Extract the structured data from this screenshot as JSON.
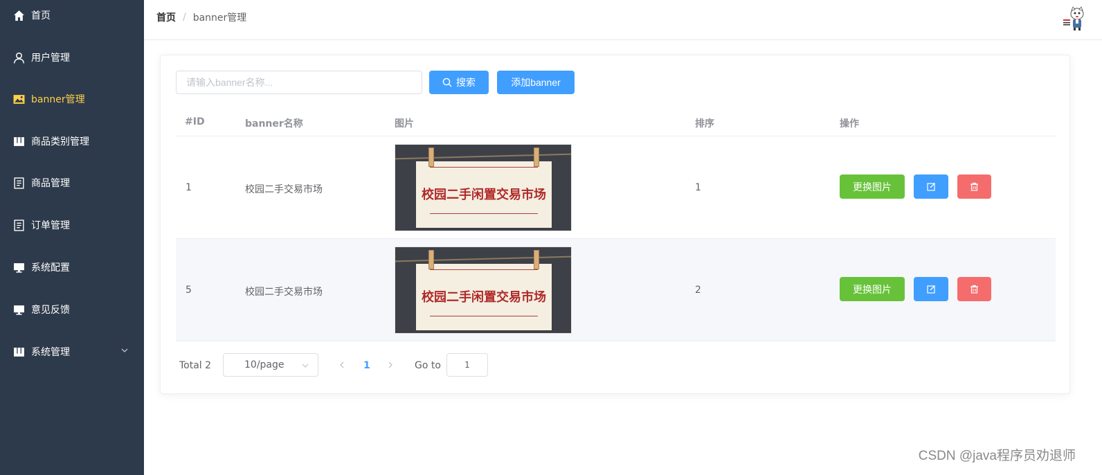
{
  "sidebar": {
    "items": [
      {
        "label": "首页",
        "icon": "home-icon"
      },
      {
        "label": "用户管理",
        "icon": "user-icon"
      },
      {
        "label": "banner管理",
        "icon": "picture-icon",
        "active": true
      },
      {
        "label": "商品类别管理",
        "icon": "category-icon"
      },
      {
        "label": "商品管理",
        "icon": "document-icon"
      },
      {
        "label": "订单管理",
        "icon": "document-icon"
      },
      {
        "label": "系统配置",
        "icon": "monitor-icon"
      },
      {
        "label": "意见反馈",
        "icon": "monitor-icon"
      },
      {
        "label": "系统管理",
        "icon": "category-icon",
        "expandable": true
      }
    ],
    "bg_color": "#2d3a4b",
    "active_color": "#ffd04b"
  },
  "header": {
    "breadcrumb_home": "首页",
    "breadcrumb_separator": "/",
    "breadcrumb_current": "banner管理"
  },
  "toolbar": {
    "search_placeholder": "请输入banner名称...",
    "search_label": "搜索",
    "add_label": "添加banner"
  },
  "table": {
    "columns": [
      "#ID",
      "banner名称",
      "图片",
      "排序",
      "操作"
    ],
    "rows": [
      {
        "id": "1",
        "name": "校园二手交易市场",
        "image_text": "校园二手闲置交易市场",
        "sort": "1"
      },
      {
        "id": "5",
        "name": "校园二手交易市场",
        "image_text": "校园二手闲置交易市场",
        "sort": "2"
      }
    ],
    "replace_label": "更换图片"
  },
  "pagination": {
    "total": "Total 2",
    "page_size": "10/page",
    "current_page": "1",
    "goto_label": "Go to",
    "goto_value": "1"
  },
  "watermark": "CSDN @java程序员劝退师",
  "colors": {
    "primary": "#409eff",
    "success": "#67c23a",
    "danger": "#f56c6c"
  }
}
